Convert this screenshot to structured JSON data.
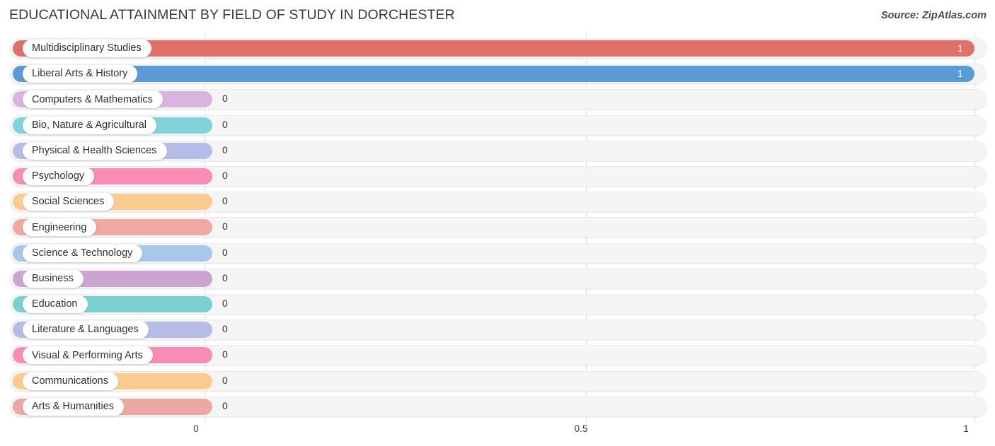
{
  "header": {
    "title": "EDUCATIONAL ATTAINMENT BY FIELD OF STUDY IN DORCHESTER",
    "source": "Source: ZipAtlas.com"
  },
  "chart_data": {
    "type": "bar",
    "orientation": "horizontal",
    "title": "EDUCATIONAL ATTAINMENT BY FIELD OF STUDY IN DORCHESTER",
    "xlabel": "",
    "ylabel": "",
    "xlim": [
      0,
      1
    ],
    "grid": true,
    "legend": "none",
    "axis_ticks": [
      {
        "label": "0",
        "value": 0
      },
      {
        "label": "0.5",
        "value": 0.5
      },
      {
        "label": "1",
        "value": 1
      }
    ],
    "categories": [
      "Multidisciplinary Studies",
      "Liberal Arts & History",
      "Computers & Mathematics",
      "Bio, Nature & Agricultural",
      "Physical & Health Sciences",
      "Psychology",
      "Social Sciences",
      "Engineering",
      "Science & Technology",
      "Business",
      "Education",
      "Literature & Languages",
      "Visual & Performing Arts",
      "Communications",
      "Arts & Humanities"
    ],
    "values": [
      1,
      1,
      0,
      0,
      0,
      0,
      0,
      0,
      0,
      0,
      0,
      0,
      0,
      0,
      0
    ],
    "value_labels": [
      "1",
      "1",
      "0",
      "0",
      "0",
      "0",
      "0",
      "0",
      "0",
      "0",
      "0",
      "0",
      "0",
      "0",
      "0"
    ],
    "colors": [
      "#e2706a",
      "#5b9bd5",
      "#d9b4de",
      "#7fd4d9",
      "#b5bce8",
      "#f98cb4",
      "#fbcb90",
      "#efa8a3",
      "#a8c7ea",
      "#cda3cf",
      "#79d0cf",
      "#b6bce8",
      "#f98cb4",
      "#fbcb90",
      "#eda8a3"
    ]
  },
  "rows": [
    {
      "label": "Multidisciplinary Studies",
      "value": "1",
      "color": "#e2706a",
      "inside": true
    },
    {
      "label": "Liberal Arts & History",
      "value": "1",
      "color": "#5b9bd5",
      "inside": true
    },
    {
      "label": "Computers & Mathematics",
      "value": "0",
      "color": "#d9b4de",
      "inside": false
    },
    {
      "label": "Bio, Nature & Agricultural",
      "value": "0",
      "color": "#7fd4d9",
      "inside": false
    },
    {
      "label": "Physical & Health Sciences",
      "value": "0",
      "color": "#b5bce8",
      "inside": false
    },
    {
      "label": "Psychology",
      "value": "0",
      "color": "#f98cb4",
      "inside": false
    },
    {
      "label": "Social Sciences",
      "value": "0",
      "color": "#fbcb90",
      "inside": false
    },
    {
      "label": "Engineering",
      "value": "0",
      "color": "#efa8a3",
      "inside": false
    },
    {
      "label": "Science & Technology",
      "value": "0",
      "color": "#a8c7ea",
      "inside": false
    },
    {
      "label": "Business",
      "value": "0",
      "color": "#cda3cf",
      "inside": false
    },
    {
      "label": "Education",
      "value": "0",
      "color": "#79d0cf",
      "inside": false
    },
    {
      "label": "Literature & Languages",
      "value": "0",
      "color": "#b6bce8",
      "inside": false
    },
    {
      "label": "Visual & Performing Arts",
      "value": "0",
      "color": "#f98cb4",
      "inside": false
    },
    {
      "label": "Communications",
      "value": "0",
      "color": "#fbcb90",
      "inside": false
    },
    {
      "label": "Arts & Humanities",
      "value": "0",
      "color": "#eda8a3",
      "inside": false
    }
  ]
}
